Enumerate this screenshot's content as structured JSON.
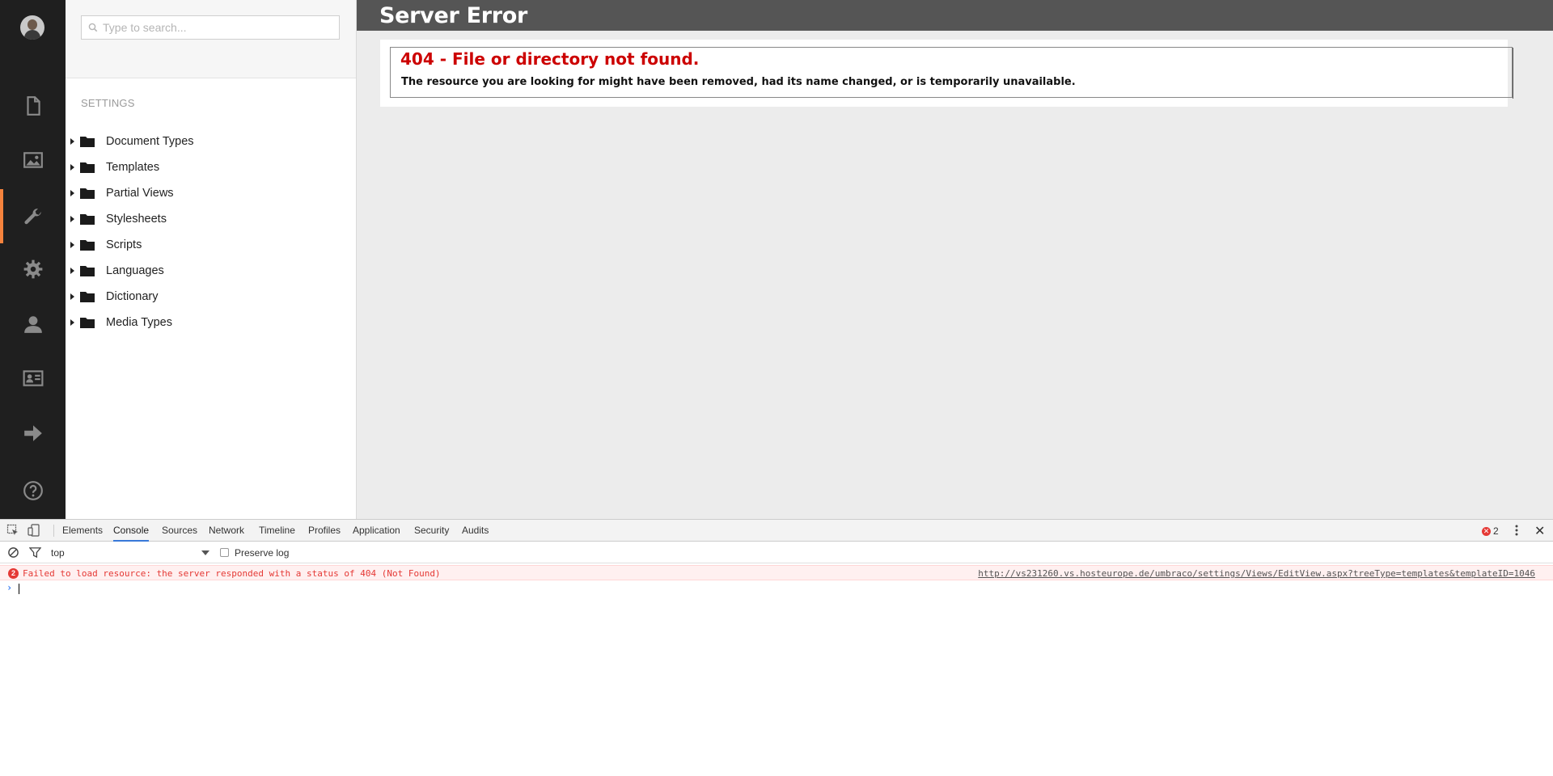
{
  "icon_bar": {
    "items": [
      {
        "icon": "document-icon"
      },
      {
        "icon": "image-icon"
      },
      {
        "icon": "wrench-icon",
        "active": true
      },
      {
        "icon": "gear-icon"
      },
      {
        "icon": "user-icon"
      },
      {
        "icon": "contact-card-icon"
      },
      {
        "icon": "arrow-right-icon"
      },
      {
        "icon": "help-icon"
      }
    ],
    "accent_color": "#f5833d"
  },
  "tree": {
    "search_placeholder": "Type to search...",
    "section_title": "SETTINGS",
    "items": [
      {
        "label": "Document Types"
      },
      {
        "label": "Templates"
      },
      {
        "label": "Partial Views"
      },
      {
        "label": "Stylesheets"
      },
      {
        "label": "Scripts"
      },
      {
        "label": "Languages"
      },
      {
        "label": "Dictionary"
      },
      {
        "label": "Media Types"
      }
    ]
  },
  "main": {
    "title": "Server Error",
    "error_title": "404 - File or directory not found.",
    "error_description": "The resource you are looking for might have been removed, had its name changed, or is temporarily unavailable.",
    "error_color": "#cc0000"
  },
  "devtools": {
    "tabs": [
      {
        "label": "Elements"
      },
      {
        "label": "Console",
        "active": true
      },
      {
        "label": "Sources"
      },
      {
        "label": "Network"
      },
      {
        "label": "Timeline"
      },
      {
        "label": "Profiles"
      },
      {
        "label": "Application"
      },
      {
        "label": "Security"
      },
      {
        "label": "Audits"
      }
    ],
    "error_count": "2",
    "context": "top",
    "preserve_log_label": "Preserve log",
    "console_error": {
      "badge": "2",
      "message": "Failed to load resource: the server responded with a status of 404 (Not Found)",
      "source": "http://vs231260.vs.hosteurope.de/umbraco/settings/Views/EditView.aspx?treeType=templates&templateID=1046"
    },
    "prompt": "›"
  }
}
